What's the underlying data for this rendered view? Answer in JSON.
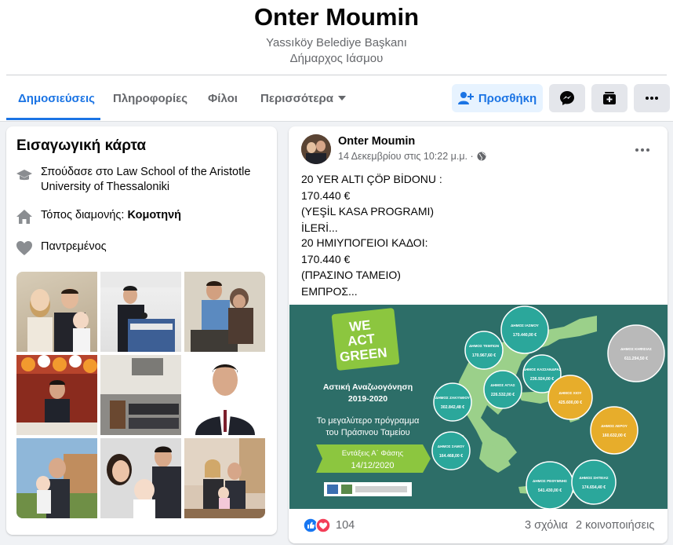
{
  "profile": {
    "name": "Onter Moumin",
    "subtitle_1": "Yassıköy Belediye Başkanı",
    "subtitle_2": "Δήμαρχος Ιάσμου"
  },
  "tabs": [
    {
      "label": "Δημοσιεύσεις",
      "active": true
    },
    {
      "label": "Πληροφορίες",
      "active": false
    },
    {
      "label": "Φίλοι",
      "active": false
    },
    {
      "label": "Περισσότερα",
      "active": false
    }
  ],
  "actions": {
    "add_friend_label": "Προσθήκη",
    "messenger_icon": "messenger-icon",
    "follow_icon": "follow-icon",
    "more_icon": "more-icon"
  },
  "intro": {
    "title": "Εισαγωγική κάρτα",
    "education": "Σπούδασε στο Law School of the Aristotle University of Thessaloniki",
    "lives_label": "Τόπος διαμονής: ",
    "lives_city": "Κομοτηνή",
    "relationship": "Παντρεμένος"
  },
  "post": {
    "author": "Onter Moumin",
    "timestamp": "14 Δεκεμβρίου στις 10:22 μ.μ. ·",
    "text_tr": [
      "20 YER ALTI ÇÖP BİDONU :",
      "170.440 €",
      "(YEŞİL KASA PROGRAMI)",
      "İLERİ..."
    ],
    "text_el": [
      "20 ΗΜΙΥΠΟΓΕΙΟΙ ΚΑΔΟΙ:",
      "170.440 €",
      "(ΠΡΑΣΙΝΟ ΤΑΜΕΙΟ)",
      "ΕΜΠΡΟΣ..."
    ],
    "image": {
      "logo": [
        "WE",
        "ACT",
        "GREEN"
      ],
      "program": "Αστική Αναζωογόνηση",
      "years": "2019-2020",
      "tagline_1": "Το μεγαλύτερο πρόγραμμα",
      "tagline_2": "του Πράσινου Ταμείου",
      "banner_1": "Εντάξεις Α΄ Φάσης",
      "banner_2": "14/12/2020",
      "bubbles": [
        {
          "name": "ΔΗΜΟΣ ΙΑΣΜΟΥ",
          "amount": "170.440,00 €"
        },
        {
          "name": "ΔΗΜΟΣ ΤΕΜΠΩΝ",
          "amount": "170.967,60 €"
        },
        {
          "name": "ΔΗΜΟΣ ΚΑΣΣΑΝΔΡΑΣ",
          "amount": "236.924,00 €"
        },
        {
          "name": "ΔΗΜΟΣ ΑΓΙΑΣ",
          "amount": "226.532,00 €"
        },
        {
          "name": "ΔΗΜΟΣ ΚΗΦΙΣΙΑΣ",
          "amount": "611.294,50 €"
        },
        {
          "name": "ΔΗΜΟΣ ΖΑΚΥΝΘΟΥ",
          "amount": "302.842,48 €"
        },
        {
          "name": "ΔΗΜΟΣ ΧΙΟΥ",
          "amount": "425.600,00 €"
        },
        {
          "name": "ΔΗΜΟΣ ΣΑΜΟΥ",
          "amount": "164.468,00 €"
        },
        {
          "name": "ΔΗΜΟΣ ΛΕΡΟΥ",
          "amount": "160.632,00 €"
        },
        {
          "name": "ΔΗΜΟΣ ΡΕΘΥΜΝΗΣ",
          "amount": "541.430,00 €"
        },
        {
          "name": "ΔΗΜΟΣ ΣΗΤΕΙΑΣ",
          "amount": "174.654,40 €"
        }
      ]
    },
    "reactions_count": "104",
    "comments": "3 σχόλια",
    "shares": "2 κοινοποιήσεις"
  }
}
